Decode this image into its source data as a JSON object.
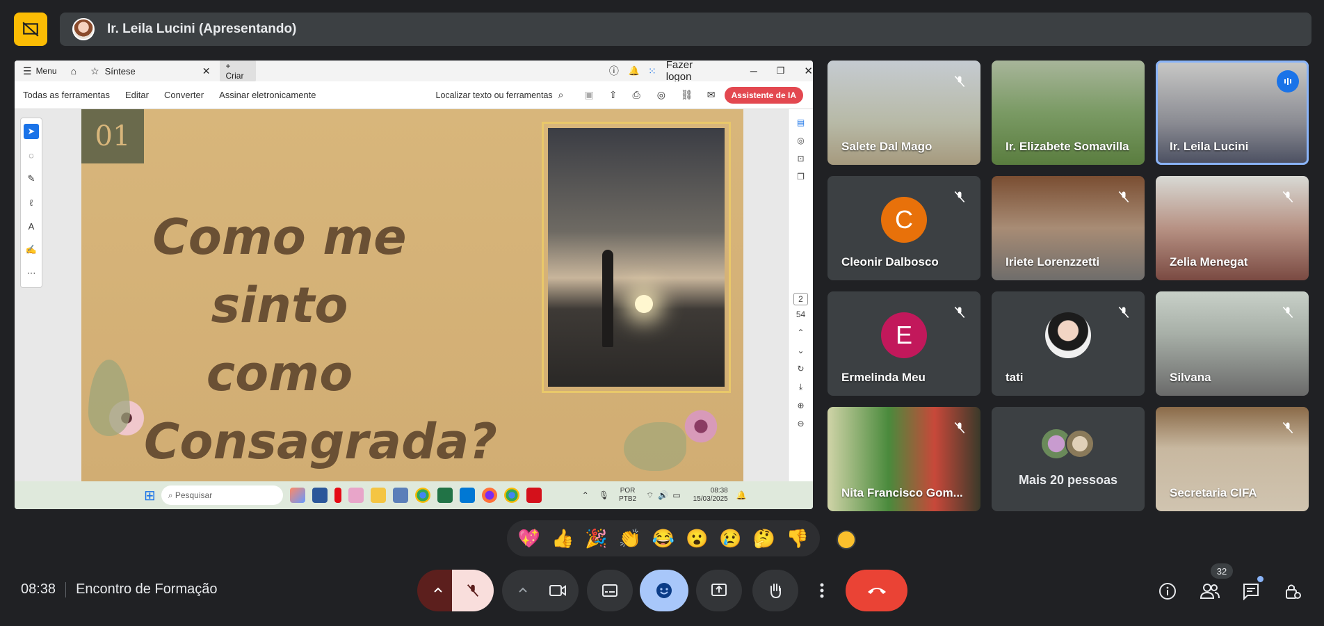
{
  "presenter_bar": {
    "name": "Ir. Leila Lucini (Apresentando)"
  },
  "screen": {
    "acrobat": {
      "menu": "Menu",
      "tab_title": "Síntese",
      "new_tab": "Criar",
      "login": "Fazer logon",
      "toolbar": [
        "Todas as ferramentas",
        "Editar",
        "Converter",
        "Assinar eletronicamente"
      ],
      "search": "Localizar texto ou ferramentas",
      "ai_assistant": "Assistente de IA",
      "page_current": "2",
      "page_total": "54"
    },
    "slide": {
      "number": "01",
      "title_lines": [
        "Como me sinto",
        "como",
        "Consagrada?"
      ]
    },
    "taskbar": {
      "search_placeholder": "Pesquisar",
      "lang": "POR",
      "layout": "PTB2",
      "time": "08:38",
      "date": "15/03/2025"
    }
  },
  "participants": [
    {
      "name": "Salete Dal Mago",
      "muted": true
    },
    {
      "name": "Ir. Elizabete Somavilla",
      "muted": false
    },
    {
      "name": "Ir. Leila Lucini",
      "muted": false,
      "speaking": true
    },
    {
      "name": "Cleonir Dalbosco",
      "muted": true,
      "initial": "C",
      "color": "#e8710a"
    },
    {
      "name": "Iriete Lorenzzetti",
      "muted": true
    },
    {
      "name": "Zelia Menegat",
      "muted": true
    },
    {
      "name": "Ermelinda Meu",
      "muted": true,
      "initial": "E",
      "color": "#c2185b"
    },
    {
      "name": "tati",
      "muted": true
    },
    {
      "name": "Silvana",
      "muted": true
    },
    {
      "name": "Nita Francisco Gom...",
      "muted": true
    },
    {
      "name": "Mais 20 pessoas"
    },
    {
      "name": "Secretaria CIFA",
      "muted": true
    }
  ],
  "reactions": [
    "💖",
    "👍",
    "🎉",
    "👏",
    "😂",
    "😮",
    "😢",
    "🤔",
    "👎"
  ],
  "meeting": {
    "time": "08:38",
    "title": "Encontro de Formação"
  },
  "people_count": "32",
  "colors": {
    "accent": "#8ab4f8",
    "end_call": "#ea4335",
    "mic_off_bg": "#f9dedc",
    "reaction_active": "#a8c7fa",
    "logo": "#fbbc04"
  }
}
